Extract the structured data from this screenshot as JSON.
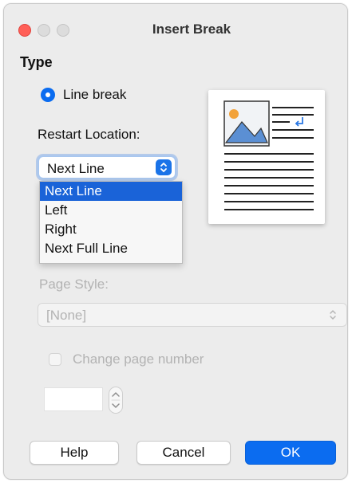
{
  "window": {
    "title": "Insert Break"
  },
  "type_section": {
    "label": "Type",
    "radio_label": "Line break"
  },
  "restart": {
    "label": "Restart Location:",
    "selected": "Next Line",
    "options": [
      "Next Line",
      "Left",
      "Right",
      "Next Full Line"
    ]
  },
  "page_style": {
    "label": "Page Style:",
    "value": "[None]"
  },
  "change_page_number": {
    "label": "Change page number"
  },
  "buttons": {
    "help": "Help",
    "cancel": "Cancel",
    "ok": "OK"
  },
  "colors": {
    "accent": "#0b6cf0",
    "selection": "#1a63d8",
    "close": "#ff5f57"
  },
  "icons": {
    "select_arrows": "up-down-chevrons-icon",
    "preview": "line-break-preview-icon"
  }
}
